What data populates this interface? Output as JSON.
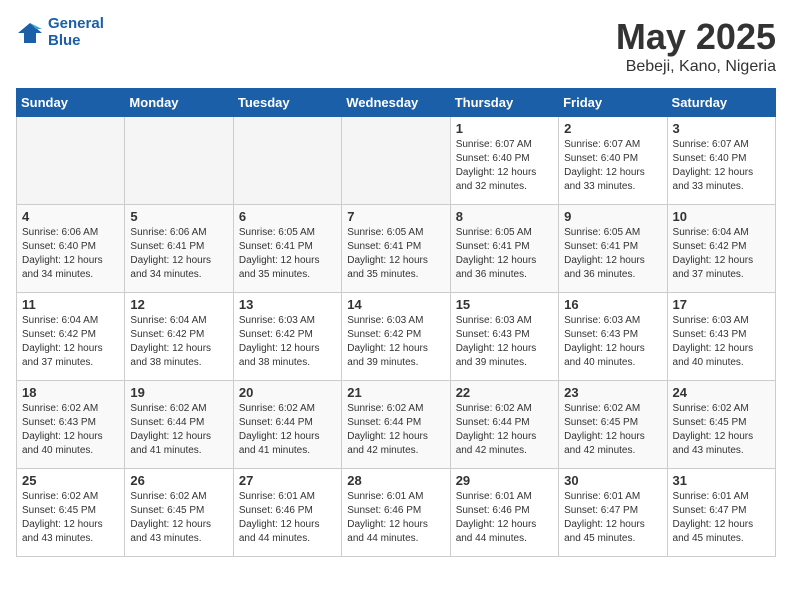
{
  "header": {
    "logo_line1": "General",
    "logo_line2": "Blue",
    "month": "May 2025",
    "location": "Bebeji, Kano, Nigeria"
  },
  "days_of_week": [
    "Sunday",
    "Monday",
    "Tuesday",
    "Wednesday",
    "Thursday",
    "Friday",
    "Saturday"
  ],
  "weeks": [
    [
      {
        "num": "",
        "info": ""
      },
      {
        "num": "",
        "info": ""
      },
      {
        "num": "",
        "info": ""
      },
      {
        "num": "",
        "info": ""
      },
      {
        "num": "1",
        "info": "Sunrise: 6:07 AM\nSunset: 6:40 PM\nDaylight: 12 hours\nand 32 minutes."
      },
      {
        "num": "2",
        "info": "Sunrise: 6:07 AM\nSunset: 6:40 PM\nDaylight: 12 hours\nand 33 minutes."
      },
      {
        "num": "3",
        "info": "Sunrise: 6:07 AM\nSunset: 6:40 PM\nDaylight: 12 hours\nand 33 minutes."
      }
    ],
    [
      {
        "num": "4",
        "info": "Sunrise: 6:06 AM\nSunset: 6:40 PM\nDaylight: 12 hours\nand 34 minutes."
      },
      {
        "num": "5",
        "info": "Sunrise: 6:06 AM\nSunset: 6:41 PM\nDaylight: 12 hours\nand 34 minutes."
      },
      {
        "num": "6",
        "info": "Sunrise: 6:05 AM\nSunset: 6:41 PM\nDaylight: 12 hours\nand 35 minutes."
      },
      {
        "num": "7",
        "info": "Sunrise: 6:05 AM\nSunset: 6:41 PM\nDaylight: 12 hours\nand 35 minutes."
      },
      {
        "num": "8",
        "info": "Sunrise: 6:05 AM\nSunset: 6:41 PM\nDaylight: 12 hours\nand 36 minutes."
      },
      {
        "num": "9",
        "info": "Sunrise: 6:05 AM\nSunset: 6:41 PM\nDaylight: 12 hours\nand 36 minutes."
      },
      {
        "num": "10",
        "info": "Sunrise: 6:04 AM\nSunset: 6:42 PM\nDaylight: 12 hours\nand 37 minutes."
      }
    ],
    [
      {
        "num": "11",
        "info": "Sunrise: 6:04 AM\nSunset: 6:42 PM\nDaylight: 12 hours\nand 37 minutes."
      },
      {
        "num": "12",
        "info": "Sunrise: 6:04 AM\nSunset: 6:42 PM\nDaylight: 12 hours\nand 38 minutes."
      },
      {
        "num": "13",
        "info": "Sunrise: 6:03 AM\nSunset: 6:42 PM\nDaylight: 12 hours\nand 38 minutes."
      },
      {
        "num": "14",
        "info": "Sunrise: 6:03 AM\nSunset: 6:42 PM\nDaylight: 12 hours\nand 39 minutes."
      },
      {
        "num": "15",
        "info": "Sunrise: 6:03 AM\nSunset: 6:43 PM\nDaylight: 12 hours\nand 39 minutes."
      },
      {
        "num": "16",
        "info": "Sunrise: 6:03 AM\nSunset: 6:43 PM\nDaylight: 12 hours\nand 40 minutes."
      },
      {
        "num": "17",
        "info": "Sunrise: 6:03 AM\nSunset: 6:43 PM\nDaylight: 12 hours\nand 40 minutes."
      }
    ],
    [
      {
        "num": "18",
        "info": "Sunrise: 6:02 AM\nSunset: 6:43 PM\nDaylight: 12 hours\nand 40 minutes."
      },
      {
        "num": "19",
        "info": "Sunrise: 6:02 AM\nSunset: 6:44 PM\nDaylight: 12 hours\nand 41 minutes."
      },
      {
        "num": "20",
        "info": "Sunrise: 6:02 AM\nSunset: 6:44 PM\nDaylight: 12 hours\nand 41 minutes."
      },
      {
        "num": "21",
        "info": "Sunrise: 6:02 AM\nSunset: 6:44 PM\nDaylight: 12 hours\nand 42 minutes."
      },
      {
        "num": "22",
        "info": "Sunrise: 6:02 AM\nSunset: 6:44 PM\nDaylight: 12 hours\nand 42 minutes."
      },
      {
        "num": "23",
        "info": "Sunrise: 6:02 AM\nSunset: 6:45 PM\nDaylight: 12 hours\nand 42 minutes."
      },
      {
        "num": "24",
        "info": "Sunrise: 6:02 AM\nSunset: 6:45 PM\nDaylight: 12 hours\nand 43 minutes."
      }
    ],
    [
      {
        "num": "25",
        "info": "Sunrise: 6:02 AM\nSunset: 6:45 PM\nDaylight: 12 hours\nand 43 minutes."
      },
      {
        "num": "26",
        "info": "Sunrise: 6:02 AM\nSunset: 6:45 PM\nDaylight: 12 hours\nand 43 minutes."
      },
      {
        "num": "27",
        "info": "Sunrise: 6:01 AM\nSunset: 6:46 PM\nDaylight: 12 hours\nand 44 minutes."
      },
      {
        "num": "28",
        "info": "Sunrise: 6:01 AM\nSunset: 6:46 PM\nDaylight: 12 hours\nand 44 minutes."
      },
      {
        "num": "29",
        "info": "Sunrise: 6:01 AM\nSunset: 6:46 PM\nDaylight: 12 hours\nand 44 minutes."
      },
      {
        "num": "30",
        "info": "Sunrise: 6:01 AM\nSunset: 6:47 PM\nDaylight: 12 hours\nand 45 minutes."
      },
      {
        "num": "31",
        "info": "Sunrise: 6:01 AM\nSunset: 6:47 PM\nDaylight: 12 hours\nand 45 minutes."
      }
    ]
  ]
}
